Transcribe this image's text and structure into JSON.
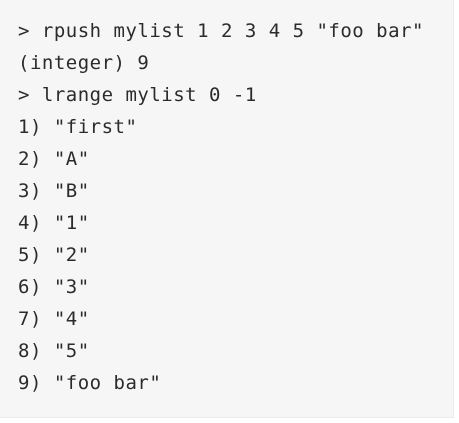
{
  "terminal": {
    "lines": [
      "> rpush mylist 1 2 3 4 5 \"foo bar\"",
      "(integer) 9",
      "> lrange mylist 0 -1",
      "1) \"first\"",
      "2) \"A\"",
      "3) \"B\"",
      "4) \"1\"",
      "5) \"2\"",
      "6) \"3\"",
      "7) \"4\"",
      "8) \"5\"",
      "9) \"foo bar\""
    ]
  }
}
